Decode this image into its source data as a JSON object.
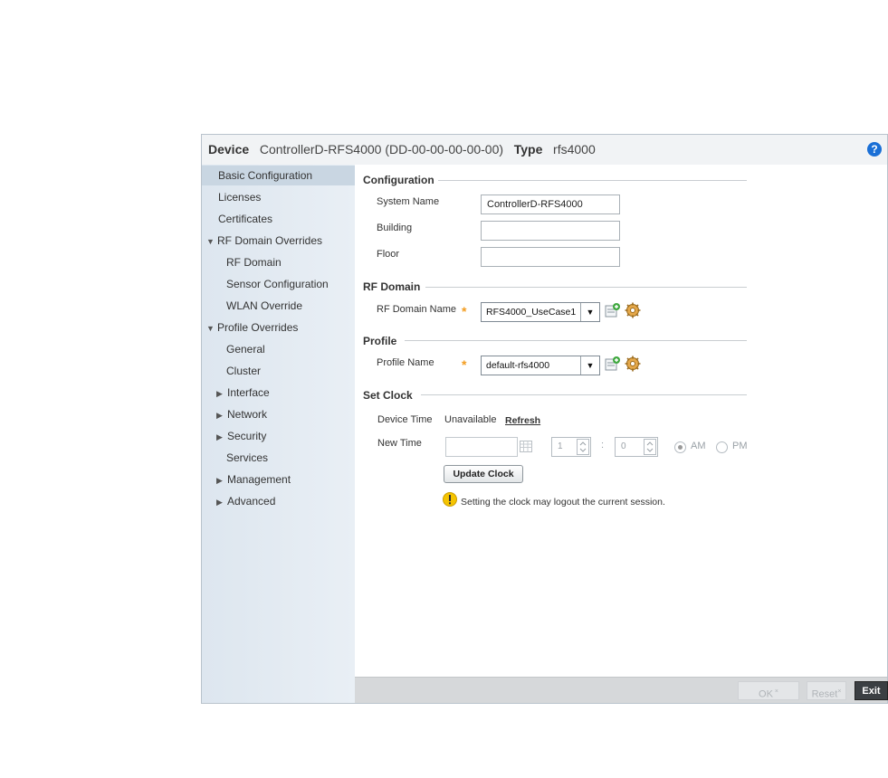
{
  "header": {
    "device_label": "Device",
    "device_value": "ControllerD-RFS4000 (DD-00-00-00-00-00)",
    "type_label": "Type",
    "type_value": "rfs4000",
    "help_icon": "help-icon"
  },
  "sidebar": {
    "items": [
      {
        "label": "Basic Configuration",
        "selected": true
      },
      {
        "label": "Licenses"
      },
      {
        "label": "Certificates"
      },
      {
        "label": "RF Domain Overrides",
        "expanded": true
      },
      {
        "label": "RF Domain"
      },
      {
        "label": "Sensor Configuration"
      },
      {
        "label": "WLAN Override"
      },
      {
        "label": "Profile Overrides",
        "expanded": true
      },
      {
        "label": "General"
      },
      {
        "label": "Cluster"
      },
      {
        "label": "Interface",
        "collapsed": true
      },
      {
        "label": "Network",
        "collapsed": true
      },
      {
        "label": "Security",
        "collapsed": true
      },
      {
        "label": "Services"
      },
      {
        "label": "Management",
        "collapsed": true
      },
      {
        "label": "Advanced",
        "collapsed": true
      }
    ]
  },
  "configuration": {
    "title": "Configuration",
    "system_name_label": "System Name",
    "system_name_value": "ControllerD-RFS4000",
    "building_label": "Building",
    "building_value": "",
    "floor_label": "Floor",
    "floor_value": ""
  },
  "rf_domain": {
    "title": "RF Domain",
    "name_label": "RF Domain Name",
    "name_value": "RFS4000_UseCase1"
  },
  "profile": {
    "title": "Profile",
    "name_label": "Profile Name",
    "name_value": "default-rfs4000"
  },
  "set_clock": {
    "title": "Set Clock",
    "device_time_label": "Device Time",
    "device_time_value": "Unavailable",
    "refresh_label": "Refresh",
    "new_time_label": "New Time",
    "new_time_date": "",
    "hour_value": "1",
    "minute_value": "0",
    "colon": ":",
    "am_label": "AM",
    "pm_label": "PM",
    "am_selected": true,
    "update_clock_label": "Update Clock",
    "warning_text": "Setting the clock may logout the current session."
  },
  "footer": {
    "ok_label": "OK",
    "reset_label": "Reset",
    "exit_label": "Exit"
  },
  "colors": {
    "accent": "#1a6fd6",
    "required_star": "#f39c1f",
    "warning": "#f5c400"
  }
}
